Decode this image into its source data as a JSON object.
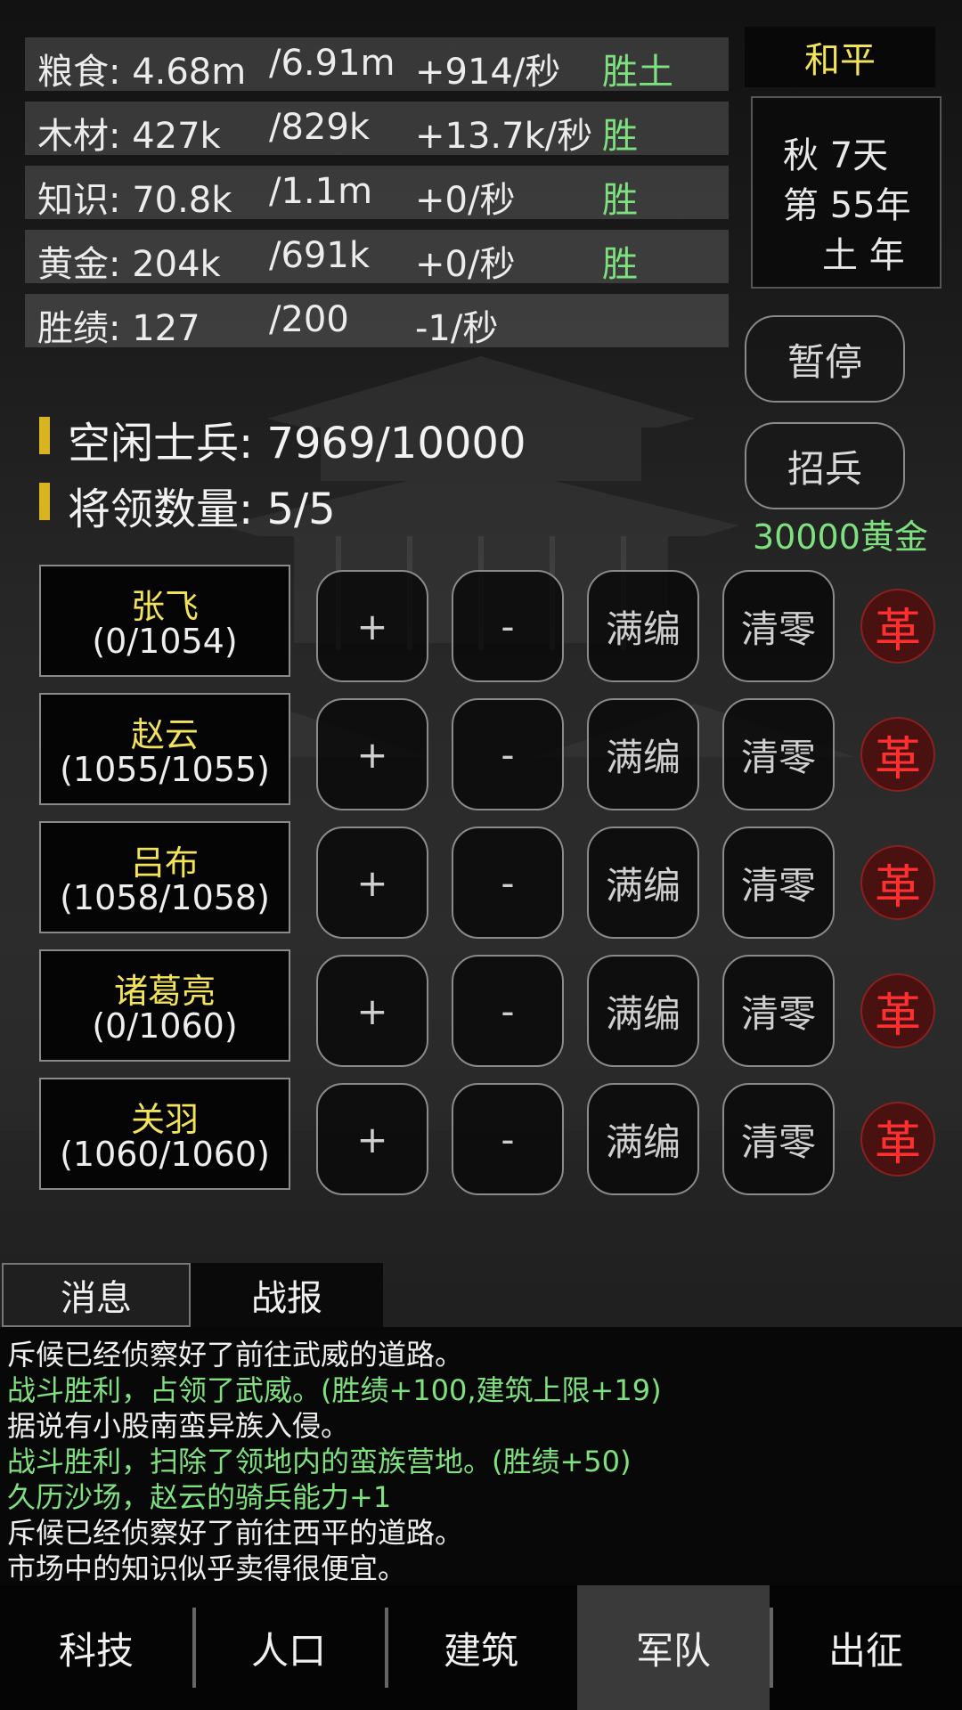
{
  "resources": [
    {
      "name": "粮食: 4.68m",
      "max": "/6.91m",
      "rate": "+914/秒",
      "tag": "胜土"
    },
    {
      "name": "木材: 427k",
      "max": "/829k",
      "rate": "+13.7k/秒",
      "tag": "胜"
    },
    {
      "name": "知识: 70.8k",
      "max": "/1.1m",
      "rate": "+0/秒",
      "tag": "胜"
    },
    {
      "name": "黄金: 204k",
      "max": "/691k",
      "rate": "+0/秒",
      "tag": "胜"
    },
    {
      "name": "胜绩: 127",
      "max": "/200",
      "rate": "-1/秒",
      "tag": ""
    }
  ],
  "status": {
    "state": "和平",
    "season": "秋 7天",
    "year": "第 55年",
    "element_year": "土 年"
  },
  "controls": {
    "pause": "暂停",
    "recruit": "招兵",
    "recruit_cost": "30000黄金"
  },
  "army": {
    "idle_label": "空闲士兵:",
    "idle_value": "7969/10000",
    "general_label": "将领数量:",
    "general_value": "5/5"
  },
  "general_buttons": {
    "plus": "+",
    "minus": "-",
    "fill": "满编",
    "clear": "清零",
    "dismiss": "革"
  },
  "generals": [
    {
      "name": "张飞",
      "count": "(0/1054)"
    },
    {
      "name": "赵云",
      "count": "(1055/1055)"
    },
    {
      "name": "吕布",
      "count": "(1058/1058)"
    },
    {
      "name": "诸葛亮",
      "count": "(0/1060)"
    },
    {
      "name": "关羽",
      "count": "(1060/1060)"
    }
  ],
  "log_tabs": [
    "消息",
    "战报"
  ],
  "log": [
    {
      "text": "斥候已经侦察好了前往武威的道路。",
      "color": "#f0f0f0"
    },
    {
      "text": "战斗胜利，占领了武威。(胜绩+100,建筑上限+19)",
      "color": "#7ee07e"
    },
    {
      "text": "据说有小股南蛮异族入侵。",
      "color": "#f0f0f0"
    },
    {
      "text": "战斗胜利，扫除了领地内的蛮族营地。(胜绩+50)",
      "color": "#7ee07e"
    },
    {
      "text": "久历沙场，赵云的骑兵能力+1",
      "color": "#7ee07e"
    },
    {
      "text": "斥候已经侦察好了前往西平的道路。",
      "color": "#f0f0f0"
    },
    {
      "text": "市场中的知识似乎卖得很便宜。",
      "color": "#f0f0f0"
    }
  ],
  "nav": [
    "科技",
    "人口",
    "建筑",
    "军队",
    "出征"
  ],
  "colors": {
    "accent_yellow": "#f2e35a",
    "positive_green": "#7ee07e",
    "dismiss_red": "#ff3030"
  }
}
